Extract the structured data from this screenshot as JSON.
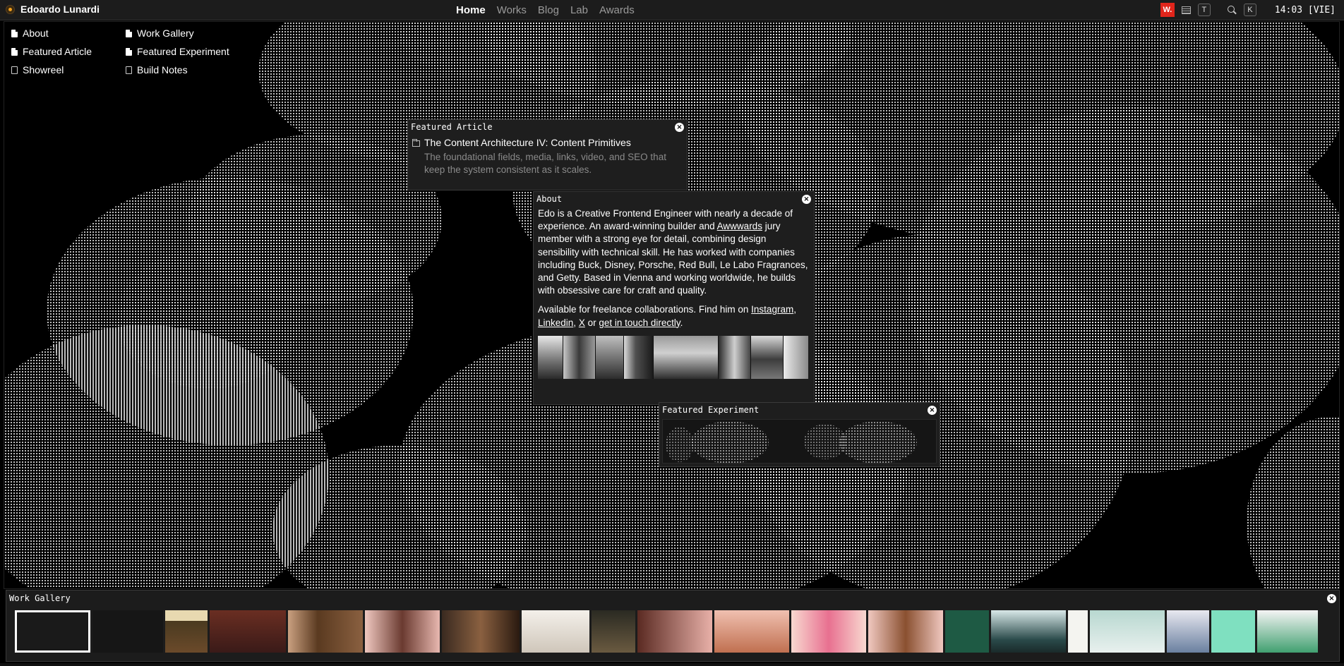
{
  "brand": {
    "name": "Edoardo Lunardi"
  },
  "nav": [
    {
      "label": "Home",
      "active": true
    },
    {
      "label": "Works",
      "active": false
    },
    {
      "label": "Blog",
      "active": false
    },
    {
      "label": "Lab",
      "active": false
    },
    {
      "label": "Awards",
      "active": false
    }
  ],
  "topbar": {
    "awwwards_badge": "W.",
    "theme_key": "T",
    "search_key": "K",
    "clock": "14:03 [VIE]"
  },
  "shortcuts": {
    "about": "About",
    "work_gallery": "Work Gallery",
    "featured_article": "Featured Article",
    "featured_experiment": "Featured Experiment",
    "showreel": "Showreel",
    "build_notes": "Build Notes"
  },
  "featured_article": {
    "title": "Featured Article",
    "article_title": "The Content Architecture IV: Content Primitives",
    "article_desc": "The foundational fields, media, links, video, and SEO that keep the system consistent as it scales."
  },
  "about": {
    "title": "About",
    "p1_a": "Edo is a Creative Frontend Engineer with nearly a decade of experience. An award-winning builder and ",
    "p1_link": "Awwwards",
    "p1_b": " jury member with a strong eye for detail, combining design sensibility with technical skill. He has worked with companies including Buck, Disney, Porsche, Red Bull, Le Labo Fragrances, and Getty. Based in Vienna and working worldwide, he builds with obsessive care for craft and quality.",
    "p2_a": "Available for freelance collaborations. Find him on ",
    "link_instagram": "Instagram",
    "sep1": ", ",
    "link_linkedin": "Linkedin",
    "sep2": ", ",
    "link_x": "X",
    "p2_or": " or ",
    "link_contact": "get in touch directly",
    "p2_end": "."
  },
  "featured_experiment": {
    "title": "Featured Experiment"
  },
  "work_gallery": {
    "title": "Work Gallery"
  },
  "colors": {
    "accent_red": "#e1251b",
    "panel_bg": "#1e1e1e",
    "muted_text": "#8a8a8a"
  },
  "icons": [
    "close-icon",
    "file-icon",
    "folder-icon",
    "search-icon",
    "list-icon"
  ]
}
